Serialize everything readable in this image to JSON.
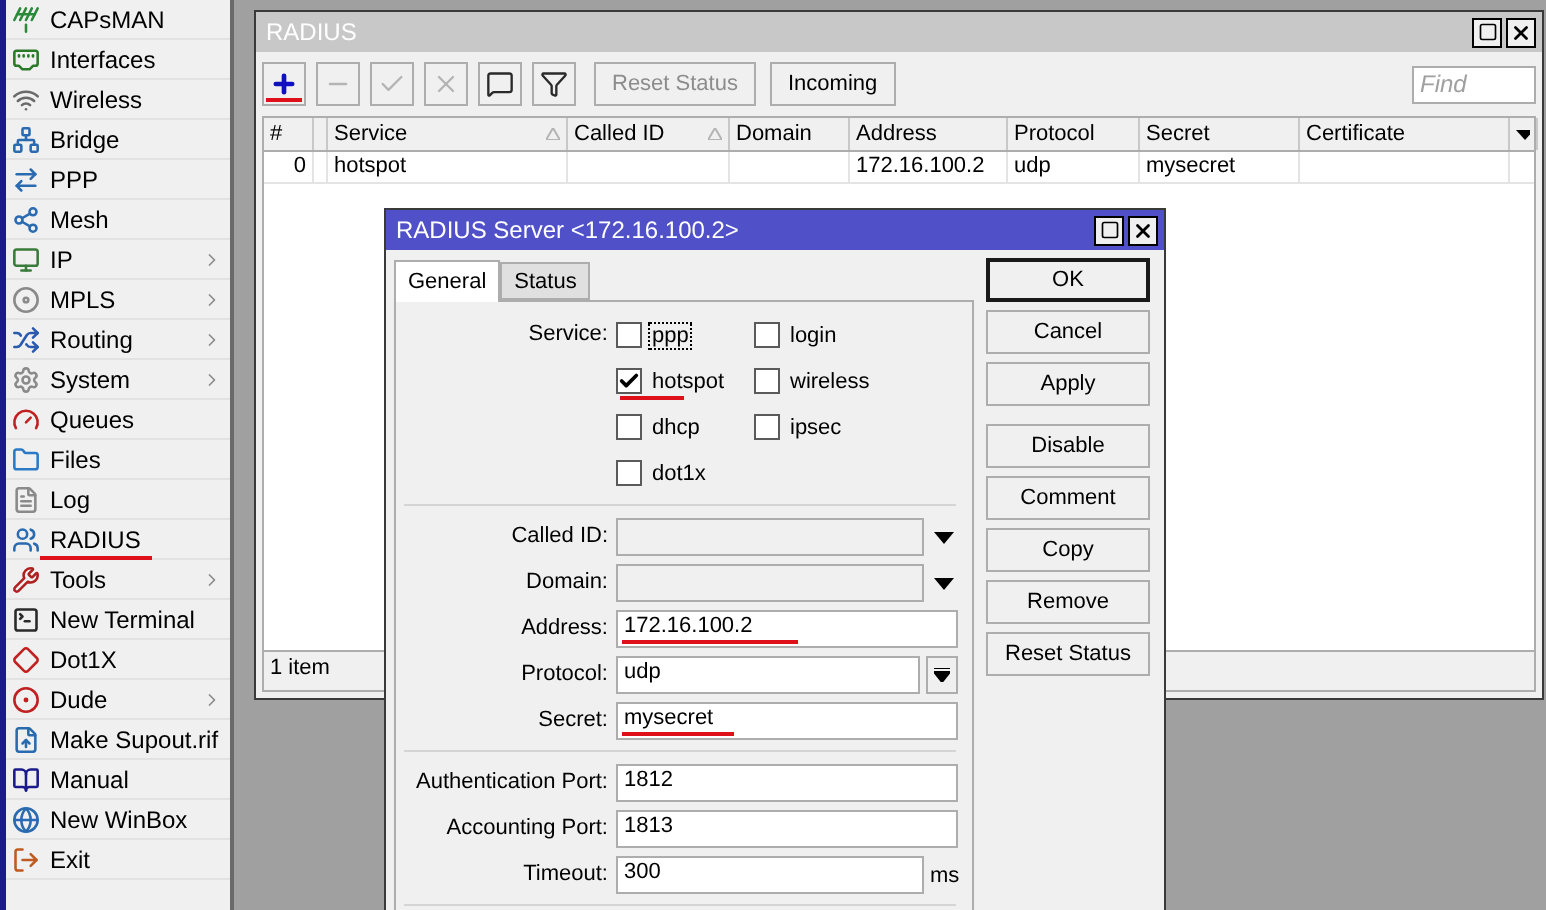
{
  "sidebar": {
    "items": [
      {
        "label": "CAPsMAN",
        "submenu": false,
        "underlined": false
      },
      {
        "label": "Interfaces",
        "submenu": false,
        "underlined": false
      },
      {
        "label": "Wireless",
        "submenu": false,
        "underlined": false
      },
      {
        "label": "Bridge",
        "submenu": false,
        "underlined": false
      },
      {
        "label": "PPP",
        "submenu": false,
        "underlined": false
      },
      {
        "label": "Mesh",
        "submenu": false,
        "underlined": false
      },
      {
        "label": "IP",
        "submenu": true,
        "underlined": false
      },
      {
        "label": "MPLS",
        "submenu": true,
        "underlined": false
      },
      {
        "label": "Routing",
        "submenu": true,
        "underlined": false
      },
      {
        "label": "System",
        "submenu": true,
        "underlined": false
      },
      {
        "label": "Queues",
        "submenu": false,
        "underlined": false
      },
      {
        "label": "Files",
        "submenu": false,
        "underlined": false
      },
      {
        "label": "Log",
        "submenu": false,
        "underlined": false
      },
      {
        "label": "RADIUS",
        "submenu": false,
        "underlined": true
      },
      {
        "label": "Tools",
        "submenu": true,
        "underlined": false
      },
      {
        "label": "New Terminal",
        "submenu": false,
        "underlined": false
      },
      {
        "label": "Dot1X",
        "submenu": false,
        "underlined": false
      },
      {
        "label": "Dude",
        "submenu": true,
        "underlined": false
      },
      {
        "label": "Make Supout.rif",
        "submenu": false,
        "underlined": false
      },
      {
        "label": "Manual",
        "submenu": false,
        "underlined": false
      },
      {
        "label": "New WinBox",
        "submenu": false,
        "underlined": false
      },
      {
        "label": "Exit",
        "submenu": false,
        "underlined": false
      }
    ]
  },
  "radius_window": {
    "title": "RADIUS",
    "toolbar": {
      "icon_buttons": [
        {
          "kind": "add",
          "disabled": false,
          "underlined": true
        },
        {
          "kind": "remove",
          "disabled": true,
          "underlined": false
        },
        {
          "kind": "enable",
          "disabled": true,
          "underlined": false
        },
        {
          "kind": "disable",
          "disabled": true,
          "underlined": false
        },
        {
          "kind": "comment",
          "disabled": false,
          "underlined": false
        },
        {
          "kind": "filter",
          "disabled": false,
          "underlined": false
        }
      ],
      "text_buttons": [
        {
          "label": "Reset Status",
          "disabled": true
        },
        {
          "label": "Incoming",
          "disabled": false
        }
      ],
      "search": {
        "placeholder": "Find"
      }
    },
    "table": {
      "columns": [
        {
          "label": "#",
          "sorted": false
        },
        {},
        {
          "label": "Service",
          "sorted": true
        },
        {
          "label": "Called ID",
          "sorted": true
        },
        {
          "label": "Domain",
          "sorted": false
        },
        {
          "label": "Address",
          "sorted": false
        },
        {
          "label": "Protocol",
          "sorted": false
        },
        {
          "label": "Secret",
          "sorted": false
        },
        {
          "label": "Certificate",
          "sorted": false
        }
      ],
      "rows": [
        [
          "0",
          null,
          "hotspot",
          null,
          null,
          "172.16.100.2",
          "udp",
          "mysecret",
          null
        ]
      ]
    },
    "status": "1 item"
  },
  "dialog": {
    "title": "RADIUS Server <172.16.100.2>",
    "tabs": [
      {
        "label": "General",
        "selected": true
      },
      {
        "label": "Status",
        "selected": false
      }
    ],
    "service": {
      "label": "Service:",
      "options": [
        {
          "label": "ppp",
          "checked": false,
          "focused": true,
          "underlined": false
        },
        {
          "label": "login",
          "checked": false,
          "focused": false,
          "underlined": false
        },
        {
          "label": "hotspot",
          "checked": true,
          "focused": false,
          "underlined": true
        },
        {
          "label": "wireless",
          "checked": false,
          "focused": false,
          "underlined": false
        },
        {
          "label": "dhcp",
          "checked": false,
          "focused": false,
          "underlined": false
        },
        {
          "label": "ipsec",
          "checked": false,
          "focused": false,
          "underlined": false
        },
        {
          "label": "dot1x",
          "checked": false,
          "focused": false,
          "underlined": false
        }
      ]
    },
    "field_groups": [
      [
        {
          "kind": "dropdown",
          "label": "Called ID:",
          "underlined": false
        },
        {
          "kind": "dropdown",
          "label": "Domain:",
          "underlined": false
        },
        {
          "kind": "text",
          "label": "Address:",
          "value": "172.16.100.2",
          "underlined": true
        },
        {
          "kind": "select",
          "label": "Protocol:",
          "value": "udp",
          "underlined": false
        },
        {
          "kind": "text",
          "label": "Secret:",
          "value": "mysecret",
          "underlined": true
        }
      ],
      [
        {
          "kind": "text",
          "label": "Authentication Port:",
          "value": "1812",
          "underlined": false
        },
        {
          "kind": "text",
          "label": "Accounting Port:",
          "value": "1813",
          "underlined": false
        },
        {
          "kind": "unit",
          "label": "Timeout:",
          "value": "300",
          "unit": "ms",
          "underlined": false
        }
      ]
    ],
    "button_groups": [
      [
        {
          "label": "OK",
          "default": true
        },
        {
          "label": "Cancel",
          "default": false
        },
        {
          "label": "Apply",
          "default": false
        }
      ],
      [
        {
          "label": "Disable",
          "default": false
        },
        {
          "label": "Comment",
          "default": false
        },
        {
          "label": "Copy",
          "default": false
        },
        {
          "label": "Remove",
          "default": false
        },
        {
          "label": "Reset Status",
          "default": false
        }
      ]
    ]
  }
}
